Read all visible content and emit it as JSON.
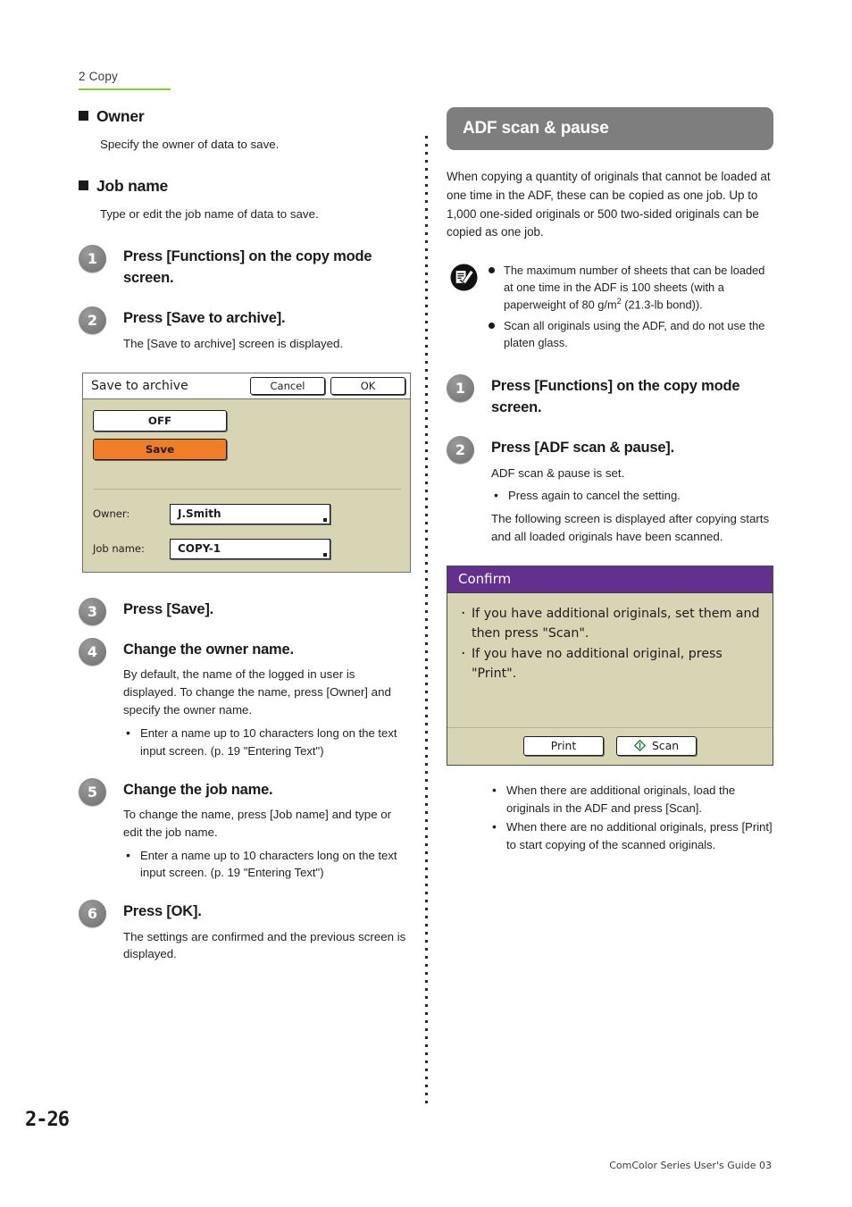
{
  "running_head": "2 Copy",
  "colors": {
    "rule_green": "#8cc63e",
    "banner_gray": "#7e7e7e",
    "lcd_khaki": "#d8d5b5",
    "save_orange": "#f07d28",
    "confirm_purple": "#63308f",
    "step_badge_gray": "#7e7e7e"
  },
  "left": {
    "owner": {
      "heading": "Owner",
      "text": "Specify the owner of data to save."
    },
    "job_name": {
      "heading": "Job name",
      "text": "Type or edit the job name of data to save."
    },
    "steps": [
      {
        "number": "1",
        "title": "Press [Functions] on the copy mode screen.",
        "desc": "",
        "bullets": []
      },
      {
        "number": "2",
        "title": "Press [Save to archive].",
        "desc": "The [Save to archive] screen is displayed.",
        "bullets": []
      },
      {
        "number": "3",
        "title": "Press [Save].",
        "desc": "",
        "bullets": []
      },
      {
        "number": "4",
        "title": "Change the owner name.",
        "desc": "By default, the name of the logged in user is displayed. To change the name, press [Owner] and specify the owner name.",
        "bullets": [
          "Enter a name up to 10 characters long on the text input screen. (p. 19 \"Entering Text\")"
        ]
      },
      {
        "number": "5",
        "title": "Change the job name.",
        "desc": "To change the name, press [Job name] and type or edit the job name.",
        "bullets": [
          "Enter a name up to 10 characters long on the text input screen. (p. 19 \"Entering Text\")"
        ]
      },
      {
        "number": "6",
        "title": "Press [OK].",
        "desc": "The settings are confirmed and the previous screen is displayed.",
        "bullets": []
      }
    ],
    "save_to_archive_screen": {
      "title": "Save to archive",
      "cancel_label": "Cancel",
      "ok_label": "OK",
      "option_off": "OFF",
      "option_save": "Save",
      "owner_label": "Owner:",
      "owner_value": "J.Smith",
      "job_name_label": "Job name:",
      "job_name_value": "COPY-1"
    }
  },
  "right": {
    "banner": "ADF scan & pause",
    "intro": "When copying a quantity of originals that cannot be loaded at one time in the ADF, these can be copied as one job. Up to 1,000 one-sided originals or 500 two-sided originals can be copied as one job.",
    "note": {
      "items": [
        {
          "pre": "The maximum number of sheets that can be loaded at one time in the ADF is 100 sheets (with a paperweight of 80 g/m",
          "sup": "2",
          "post": " (21.3-lb bond))."
        },
        {
          "pre": "Scan all originals using the ADF, and do not use the platen glass.",
          "sup": "",
          "post": ""
        }
      ]
    },
    "steps": [
      {
        "number": "1",
        "title": "Press [Functions] on the copy mode screen.",
        "desc": "",
        "bullets": [],
        "desc2": ""
      },
      {
        "number": "2",
        "title": "Press [ADF scan & pause].",
        "desc": "ADF scan & pause is set.",
        "bullets": [
          "Press again to cancel the setting."
        ],
        "desc2": "The following screen is displayed after copying starts and all loaded originals have been scanned."
      }
    ],
    "confirm_screen": {
      "title": "Confirm",
      "lines": [
        "If you have additional originals, set them and then press \"Scan\".",
        "If you have no additional original, press \"Print\"."
      ],
      "print_label": "Print",
      "scan_label": "Scan"
    },
    "after_bullets": [
      "When there are additional originals, load the originals in the ADF and press [Scan].",
      "When there are no additional originals, press [Print] to start copying of the scanned originals."
    ]
  },
  "footer": {
    "folio": "2-26",
    "guide": "ComColor Series User's Guide 03"
  }
}
